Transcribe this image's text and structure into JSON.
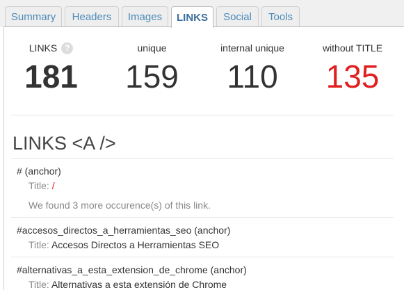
{
  "tabs": [
    {
      "label": "Summary",
      "active": false
    },
    {
      "label": "Headers",
      "active": false
    },
    {
      "label": "Images",
      "active": false
    },
    {
      "label": "LINKS",
      "active": true
    },
    {
      "label": "Social",
      "active": false
    },
    {
      "label": "Tools",
      "active": false
    }
  ],
  "stats": [
    {
      "label": "LINKS",
      "value": "181",
      "help_icon": "question-mark"
    },
    {
      "label": "unique",
      "value": "159"
    },
    {
      "label": "internal unique",
      "value": "110"
    },
    {
      "label": "without TITLE",
      "value": "135",
      "color": "#e02020"
    }
  ],
  "section": {
    "title": "LINKS <A />"
  },
  "links": [
    {
      "href": "# (anchor)",
      "title_label": "Title:",
      "title": "/",
      "note": "We found 3 more occurence(s) of this link."
    },
    {
      "href": "#accesos_directos_a_herramientas_seo (anchor)",
      "title_label": "Title:",
      "title": "Accesos Directos a Herramientas SEO"
    },
    {
      "href": "#alternativas_a_esta_extension_de_chrome (anchor)",
      "title_label": "Title:",
      "title": "Alternativas a esta extensión de Chrome"
    }
  ]
}
